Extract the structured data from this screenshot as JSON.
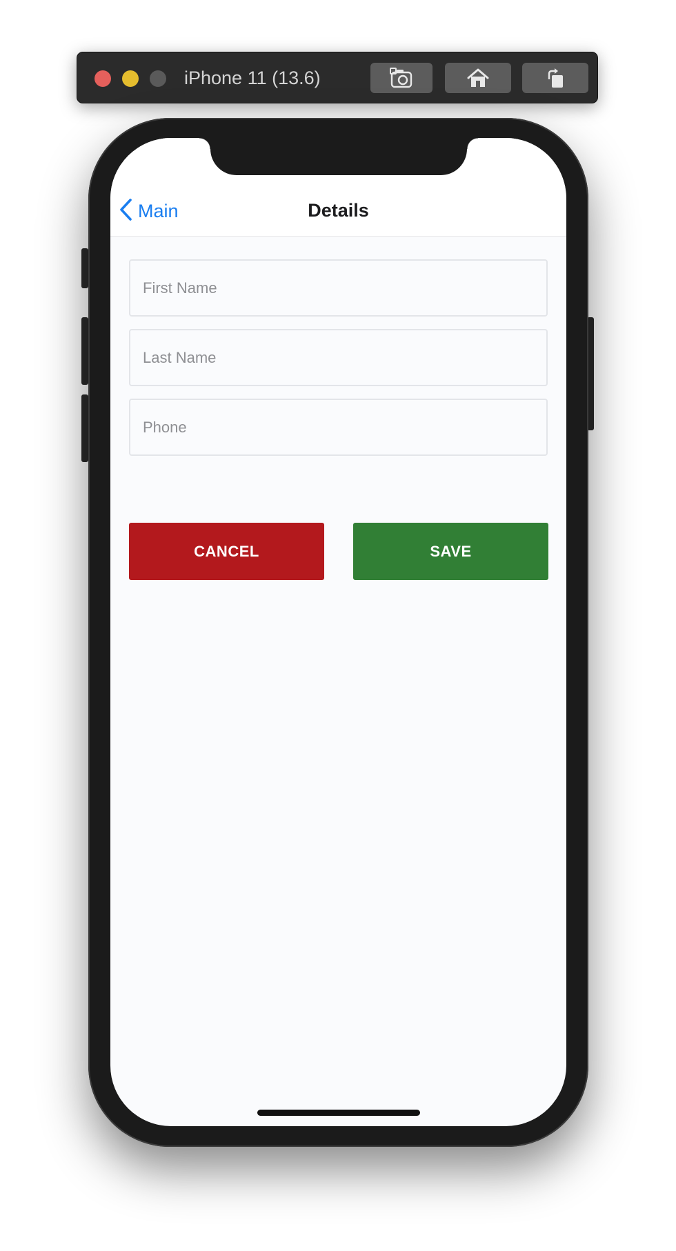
{
  "simulator": {
    "title": "iPhone 11 (13.6)",
    "traffic_colors": {
      "close": "#e5605c",
      "minimize": "#e5bd2e",
      "zoom": "#5a5a5a"
    },
    "toolbar_icons": [
      "camera-icon",
      "home-icon",
      "rotate-icon"
    ]
  },
  "navbar": {
    "back_label": "Main",
    "title": "Details",
    "accent": "#1a7ef0"
  },
  "form": {
    "first_name": {
      "placeholder": "First Name",
      "value": ""
    },
    "last_name": {
      "placeholder": "Last Name",
      "value": ""
    },
    "phone": {
      "placeholder": "Phone",
      "value": ""
    }
  },
  "actions": {
    "cancel_label": "CANCEL",
    "cancel_color": "#b3191d",
    "save_label": "SAVE",
    "save_color": "#317f35"
  }
}
